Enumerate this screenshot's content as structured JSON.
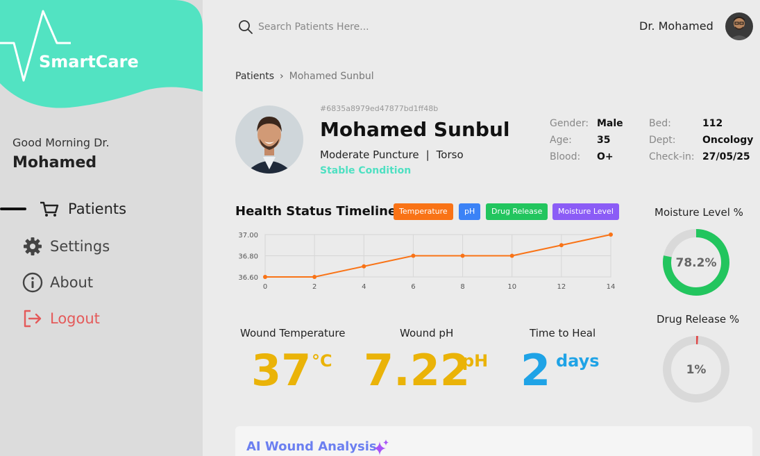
{
  "app": {
    "name": "SmartCare"
  },
  "sidebar": {
    "greeting": "Good Morning Dr.",
    "doctor_name": "Mohamed",
    "items": [
      {
        "label": "Patients",
        "icon": "cart-icon",
        "active": true
      },
      {
        "label": "Settings",
        "icon": "gear-icon"
      },
      {
        "label": "About",
        "icon": "info-icon"
      },
      {
        "label": "Logout",
        "icon": "logout-icon"
      }
    ]
  },
  "header": {
    "search_placeholder": "Search Patients Here...",
    "user_name": "Dr. Mohamed"
  },
  "breadcrumb": {
    "root": "Patients",
    "separator": "›",
    "current": "Mohamed Sunbul"
  },
  "patient": {
    "id": "#6835a8979ed47877bd1ff48b",
    "name": "Mohamed Sunbul",
    "condition": "Moderate Puncture",
    "location": "Torso",
    "status": "Stable Condition",
    "status_color": "#4fe0c2",
    "gender_label": "Gender:",
    "gender": "Male",
    "age_label": "Age:",
    "age": "35",
    "blood_label": "Blood:",
    "blood": "O+",
    "bed_label": "Bed:",
    "bed": "112",
    "dept_label": "Dept:",
    "dept": "Oncology",
    "checkin_label": "Check-in:",
    "checkin": "27/05/25"
  },
  "timeline": {
    "title": "Health Status Timeline",
    "chips": [
      {
        "label": "Temperature",
        "color": "#f97316"
      },
      {
        "label": "pH",
        "color": "#3b82f6"
      },
      {
        "label": "Drug Release",
        "color": "#22c55e"
      },
      {
        "label": "Moisture Level",
        "color": "#8b5cf6"
      }
    ]
  },
  "chart_data": {
    "type": "line",
    "x": [
      0,
      2,
      4,
      6,
      8,
      10,
      12,
      14
    ],
    "series": [
      {
        "values": [
          36.6,
          36.6,
          36.7,
          36.8,
          36.8,
          36.8,
          36.9,
          37.0
        ],
        "color": "#f97316"
      }
    ],
    "xticks": [
      "0",
      "2",
      "4",
      "6",
      "8",
      "10",
      "12",
      "14"
    ],
    "yticks": [
      "36.60",
      "36.80",
      "37.00"
    ],
    "ylim": [
      36.6,
      37.0
    ],
    "xlim": [
      0,
      14
    ],
    "grid": true
  },
  "metrics": {
    "temperature": {
      "label": "Wound Temperature",
      "value": "37",
      "unit": "°C",
      "color": "#eab308"
    },
    "ph": {
      "label": "Wound pH",
      "value": "7.22",
      "unit": "pH",
      "color": "#eab308"
    },
    "heal": {
      "label": "Time to Heal",
      "value": "2",
      "unit": "days",
      "color": "#1fa3e6"
    }
  },
  "donuts": {
    "moisture": {
      "label": "Moisture Level %",
      "value": 78.2,
      "text": "78.2%",
      "color": "#22c55e"
    },
    "drug": {
      "label": "Drug Release %",
      "value": 1,
      "text": "1%",
      "color": "#e04b4b"
    }
  },
  "ai": {
    "title": "AI Wound Analysis"
  }
}
